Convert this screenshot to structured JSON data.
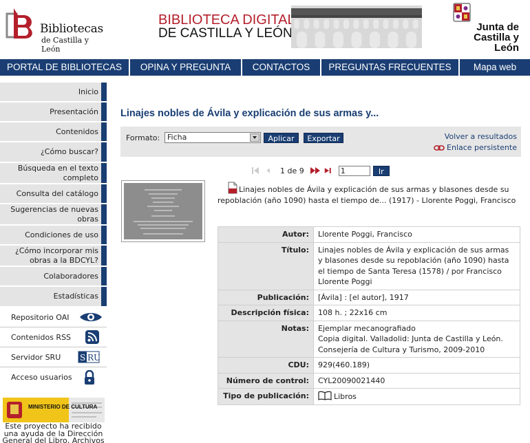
{
  "header": {
    "logo_line1": "Bibliotecas",
    "logo_line2": "de Castilla y León",
    "title_line1": "BIBLIOTECA DIGITAL",
    "title_line2": "DE CASTILLA Y LEÓN",
    "junta_line1": "Junta de",
    "junta_line2": "Castilla y León",
    "accent_red": "#b41f2c"
  },
  "topnav": {
    "color": "#1a3e73",
    "items": [
      {
        "label": "PORTAL DE BIBLIOTECAS"
      },
      {
        "label": "OPINA Y PREGUNTA"
      },
      {
        "label": "CONTACTOS"
      },
      {
        "label": "PREGUNTAS FRECUENTES"
      },
      {
        "label": "Mapa web"
      }
    ]
  },
  "sidebar": {
    "items": [
      {
        "label": "Inicio"
      },
      {
        "label": "Presentación"
      },
      {
        "label": "Contenidos"
      },
      {
        "label": "¿Cómo buscar?"
      },
      {
        "label": "Búsqueda en el texto completo"
      },
      {
        "label": "Consulta del catálogo"
      },
      {
        "label": "Sugerencias de nuevas obras"
      },
      {
        "label": "Condiciones de uso"
      },
      {
        "label": "¿Cómo incorporar mis obras a la BDCYL?"
      },
      {
        "label": "Colaboradores"
      },
      {
        "label": "Estadísticas"
      }
    ],
    "links": [
      {
        "label": "Repositorio OAI",
        "icon": "oai-icon"
      },
      {
        "label": "Contenidos RSS",
        "icon": "rss-icon"
      },
      {
        "label": "Servidor SRU",
        "icon": "sru-icon"
      },
      {
        "label": "Acceso usuarios",
        "icon": "lock-icon"
      }
    ],
    "ministerio_label": "MINISTERIO DE CULTURA",
    "project_text": "Este proyecto ha recibido una ayuda de la Dirección General del Libro, Archivos"
  },
  "main": {
    "page_title": "Linajes nobles de Ávila y explicación de sus armas y...",
    "toolbar": {
      "format_label": "Formato:",
      "format_value": "Ficha",
      "apply_label": "Aplicar",
      "export_label": "Exportar",
      "back_label": "Volver a resultados",
      "permalink_label": "Enlace persistente"
    },
    "pager": {
      "position_text": "1 de 9",
      "page_value": "1",
      "go_label": "Ir"
    },
    "record_heading": "Linajes nobles de Ávila y explicación de sus armas y blasones desde su repoblación (año 1090) hasta el tiempo de... (1917) - Llorente Poggi, Francisco",
    "details": [
      {
        "key": "Autor:",
        "value": "Llorente Poggi, Francisco"
      },
      {
        "key": "Título:",
        "value": "Linajes nobles de Ávila y explicación de sus armas y blasones desde su repoblación (año 1090) hasta el tiempo de Santa Teresa (1578) / por Francisco Llorente Poggi"
      },
      {
        "key": "Publicación:",
        "value": "[Ávila] : [el autor], 1917"
      },
      {
        "key": "Descripción física:",
        "value": "108 h. ; 22x16 cm"
      },
      {
        "key": "Notas:",
        "value": "Ejemplar mecanografiado",
        "value2": "Copia digital. Valladolid: Junta de Castilla y León. Consejería de Cultura y Turismo, 2009-2010"
      },
      {
        "key": "CDU:",
        "value": "929(460.189)"
      },
      {
        "key": "Número de control:",
        "value": "CYL20090021440"
      },
      {
        "key": "Tipo de publicación:",
        "value": "Libros",
        "icon": "book-icon"
      }
    ]
  }
}
